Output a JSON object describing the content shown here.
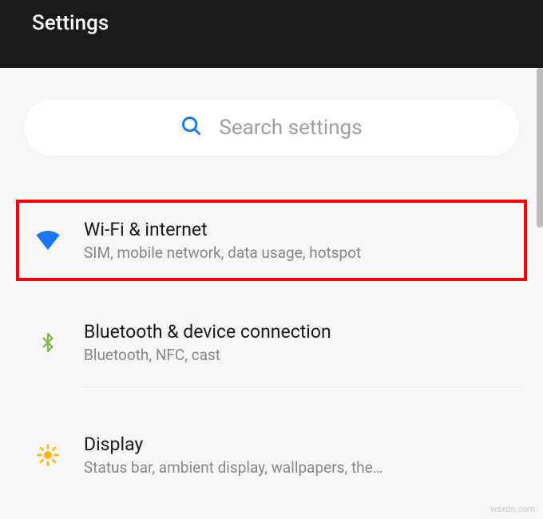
{
  "header": {
    "title": "Settings"
  },
  "search": {
    "placeholder": "Search settings"
  },
  "items": [
    {
      "title": "Wi-Fi & internet",
      "subtitle": "SIM, mobile network, data usage, hotspot"
    },
    {
      "title": "Bluetooth & device connection",
      "subtitle": "Bluetooth, NFC, cast"
    },
    {
      "title": "Display",
      "subtitle": "Status bar, ambient display, wallpapers, the…"
    }
  ],
  "watermark": "wsxdn.com"
}
